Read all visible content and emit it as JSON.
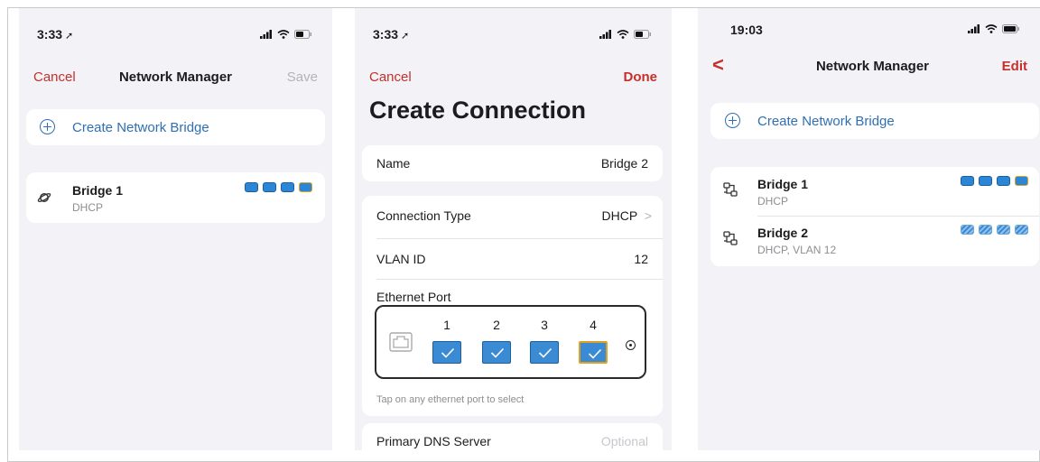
{
  "screen1": {
    "status_time": "3:33",
    "status_arrow": "➚",
    "nav": {
      "cancel": "Cancel",
      "title": "Network Manager",
      "save": "Save"
    },
    "create_bridge": "Create Network Bridge",
    "bridge": {
      "name": "Bridge 1",
      "sub": "DHCP",
      "icon": "planet-icon",
      "ports": 4
    }
  },
  "screen2": {
    "status_time": "3:33",
    "status_arrow": "➚",
    "nav": {
      "cancel": "Cancel",
      "done": "Done"
    },
    "title": "Create Connection",
    "name": {
      "label": "Name",
      "value": "Bridge 2"
    },
    "connection_type": {
      "label": "Connection Type",
      "value": "DHCP",
      "chevron": ">"
    },
    "vlan": {
      "label": "VLAN ID",
      "value": "12"
    },
    "ethernet": {
      "label": "Ethernet Port",
      "ports": [
        "1",
        "2",
        "3",
        "4"
      ],
      "hint": "Tap on any ethernet port to select"
    },
    "dns": {
      "label": "Primary DNS Server",
      "placeholder": "Optional"
    }
  },
  "screen3": {
    "status_time": "19:03",
    "nav": {
      "back": "<",
      "title": "Network Manager",
      "edit": "Edit"
    },
    "create_bridge": "Create Network Bridge",
    "bridges": [
      {
        "name": "Bridge 1",
        "sub": "DHCP",
        "icon": "network-icon"
      },
      {
        "name": "Bridge 2",
        "sub": "DHCP, VLAN 12",
        "icon": "network-icon"
      }
    ]
  },
  "colors": {
    "accent_red": "#c4302b",
    "accent_blue": "#2f6fb3",
    "port_blue": "#2b86d6",
    "selected_port": "#e0a020",
    "background": "#f2f2f7"
  }
}
